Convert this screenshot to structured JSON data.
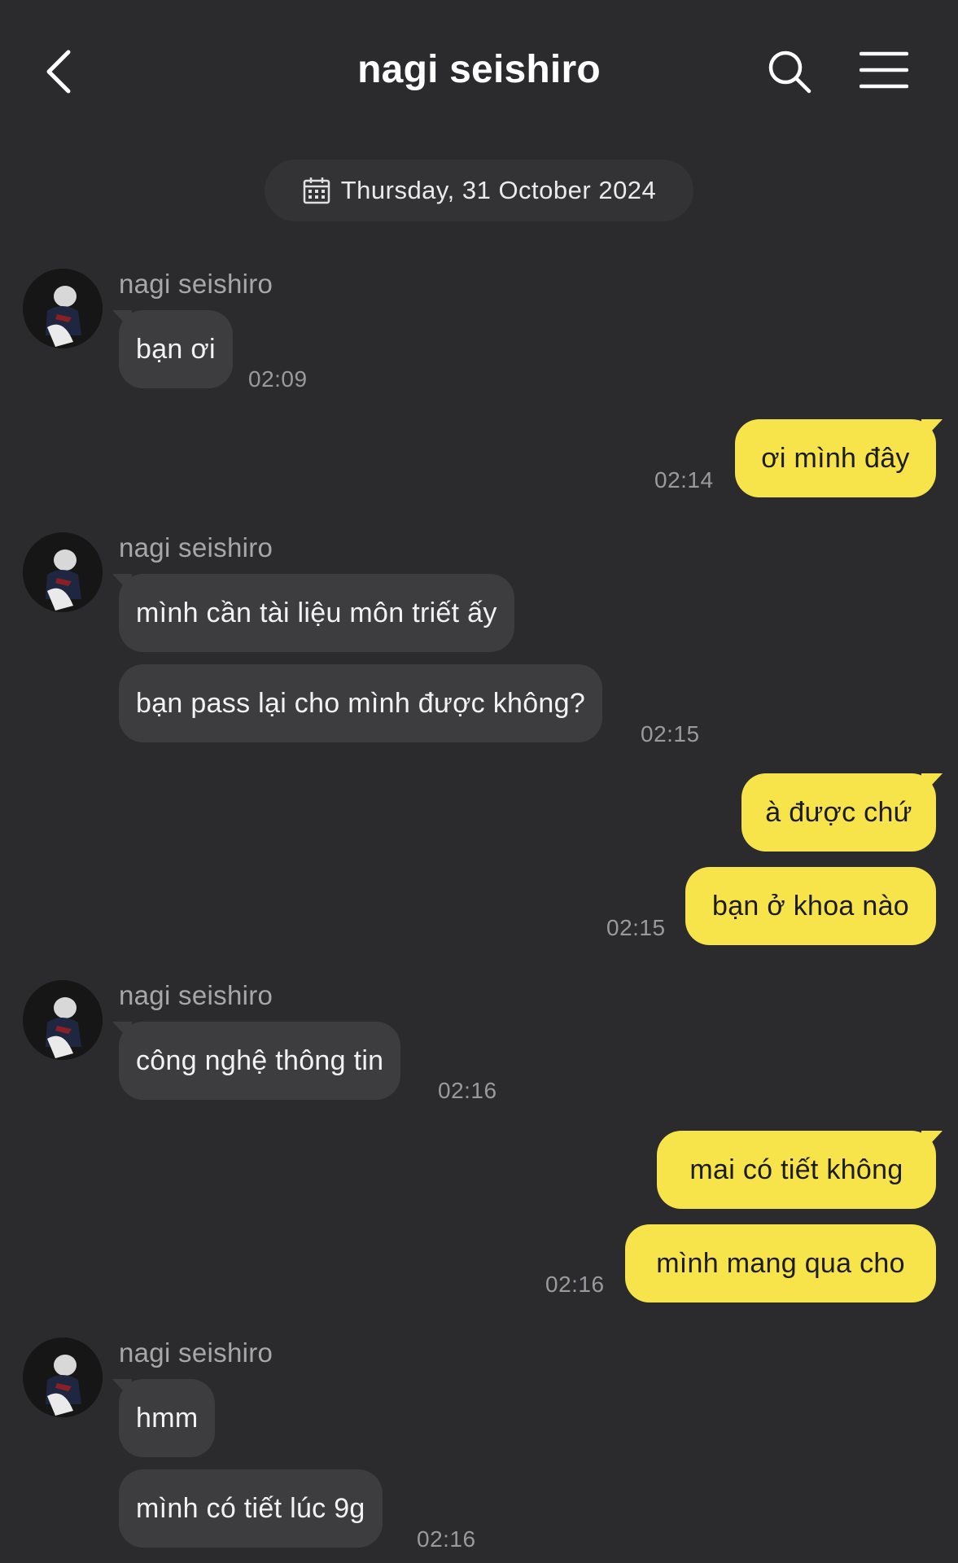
{
  "header": {
    "title": "nagi seishiro",
    "back_icon": "chevron-left-icon",
    "search_icon": "search-icon",
    "menu_icon": "hamburger-menu-icon"
  },
  "date_divider": {
    "label": "Thursday, 31 October 2024",
    "icon": "calendar-icon"
  },
  "colors": {
    "background": "#2b2b2d",
    "incoming_bubble": "#3d3d40",
    "outgoing_bubble": "#f7e34a",
    "timestamp": "#9a9a9d"
  },
  "messages": [
    {
      "sender": "nagi seishiro",
      "text": "bạn ơi",
      "time": "02:09"
    },
    {
      "text": "ơi mình đây",
      "time": "02:14"
    },
    {
      "sender": "nagi seishiro",
      "text": "mình cần tài liệu môn triết ấy"
    },
    {
      "text": "bạn pass lại cho mình được không?",
      "time": "02:15"
    },
    {
      "text": "à được chứ"
    },
    {
      "text": "bạn ở khoa nào",
      "time": "02:15"
    },
    {
      "sender": "nagi seishiro",
      "text": "công nghệ thông tin",
      "time": "02:16"
    },
    {
      "text": "mai có tiết không"
    },
    {
      "text": "mình mang qua cho",
      "time": "02:16"
    },
    {
      "sender": "nagi seishiro",
      "text": "hmm"
    },
    {
      "text": "mình có tiết lúc 9g",
      "time": "02:16"
    }
  ]
}
